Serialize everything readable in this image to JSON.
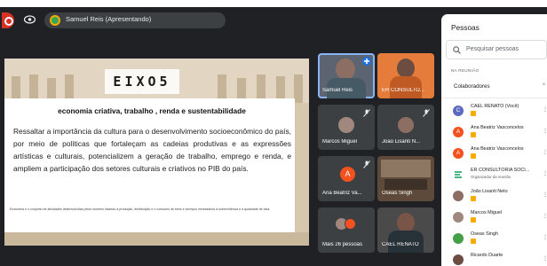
{
  "presenter": {
    "label": "Samuel Reis (Apresentando)"
  },
  "slide": {
    "heading": "EIXO5",
    "subtitle": "economia criativa, trabalho , renda e sustentabilidade",
    "body": "Ressaltar a importância da cultura para o desenvolvimento socioeconômico do país, por meio de políticas que fortaleçam as cadeias produtivas e as expressões artísticas e culturais, potencializem a geração de trabalho, emprego e renda, e ampliem a participação dos setores culturais e criativos no PIB do país.",
    "footnote": "Economia é o conjunto de atividades desenvolvidas pelos homens visando a produção, distribuição e o consumo de bens e serviços necessários à sobrevivência e à qualidade de vida."
  },
  "tiles": [
    {
      "name": "Samuel Reis"
    },
    {
      "name": "ER CONSULTO..."
    },
    {
      "name": "Marcos Miguel"
    },
    {
      "name": "João Lisanti N..."
    },
    {
      "name": "Ana Beatriz Va...",
      "initial": "A"
    },
    {
      "name": "Oseas Singh"
    },
    {
      "name": "Mais 26 pessoas"
    },
    {
      "name": "CAEL RENATO"
    }
  ],
  "sidebar": {
    "title": "Pessoas",
    "search_placeholder": "Pesquisar pessoas",
    "section": "NA REUNIÃO",
    "group": "Colaboradores",
    "participants": [
      {
        "name": "CAEL RENATO (Você)",
        "initial": "C",
        "color": "#5c6bc0"
      },
      {
        "name": "Ana Beatriz Vasconcelos",
        "initial": "A",
        "color": "#f4511e"
      },
      {
        "name": "Ana Beatriz Vasconcelos",
        "initial": "A",
        "color": "#f4511e"
      },
      {
        "name": "ER CONSULTORIA SOCI...",
        "sub": "Organizador da reunião",
        "color": "#0f9d58"
      },
      {
        "name": "João Lisanti Neto"
      },
      {
        "name": "Marcos Miguel"
      },
      {
        "name": "Oseas Singh"
      },
      {
        "name": "Ricardo Duarte"
      }
    ]
  },
  "colors": {
    "accent": "#8ab4f8",
    "avatar_orange": "#f4511e",
    "record": "#d93025",
    "badge": "#f9ab00"
  }
}
